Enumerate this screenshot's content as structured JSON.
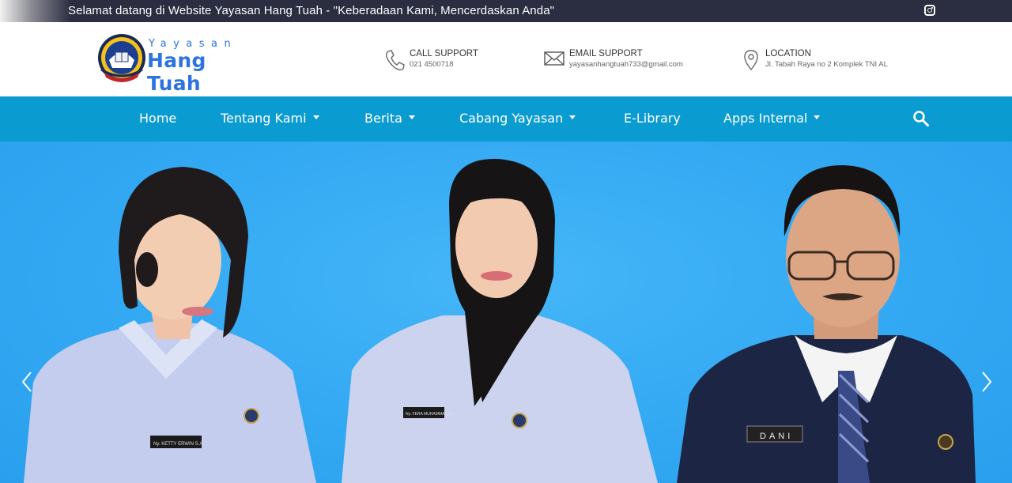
{
  "topbar": {
    "announcement": "Selamat datang di Website Yayasan Hang Tuah - \"Keberadaan Kami, Mencerdaskan Anda\"",
    "social_icon": "instagram-icon"
  },
  "logo": {
    "line1": "Yayasan",
    "line2": "Hang Tuah",
    "emblem_text": "YAYASAN HANG TUAH"
  },
  "contacts": [
    {
      "icon": "phone-icon",
      "title": "CALL SUPPORT",
      "value": "021 4500718"
    },
    {
      "icon": "mail-icon",
      "title": "EMAIL SUPPORT",
      "value": "yayasanhangtuah733@gmail.com"
    },
    {
      "icon": "location-pin-icon",
      "title": "LOCATION",
      "value": "Jl. Tabah Raya no 2 Komplek TNI AL"
    }
  ],
  "nav": {
    "items": [
      {
        "label": "Home",
        "dropdown": false
      },
      {
        "label": "Tentang Kami",
        "dropdown": true
      },
      {
        "label": "Berita",
        "dropdown": true
      },
      {
        "label": "Cabang Yayasan",
        "dropdown": true
      },
      {
        "label": "E-Library",
        "dropdown": false
      },
      {
        "label": "Apps Internal",
        "dropdown": true
      }
    ],
    "search_icon": "search-icon"
  },
  "hero": {
    "name_tags": [
      "Ny. KETTY ERWIN S.A.",
      "Ny. FERA MUHAMMAD ALI",
      "DANI"
    ],
    "prev_icon": "chevron-left-icon",
    "next_icon": "chevron-right-icon"
  },
  "colors": {
    "topbar_bg": "#2b2d40",
    "nav_bg": "#0a9bd0",
    "brand_blue": "#2d74e0",
    "hero_bg": "#33a9f3"
  }
}
